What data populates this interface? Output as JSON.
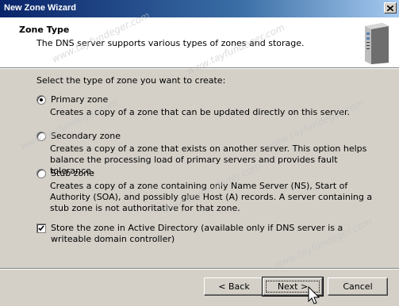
{
  "window": {
    "title": "New Zone Wizard",
    "close_glyph": "✕"
  },
  "header": {
    "title": "Zone Type",
    "subtitle": "The DNS server supports various types of zones and storage.",
    "icon": "server-icon"
  },
  "body": {
    "prompt": "Select the type of zone you want to create:",
    "options": [
      {
        "label": "Primary zone",
        "description": "Creates a copy of a zone that can be updated directly on this server.",
        "selected": true
      },
      {
        "label": "Secondary zone",
        "description": "Creates a copy of a zone that exists on another server. This option helps balance the processing load of primary servers and provides fault tolerance.",
        "selected": false
      },
      {
        "label": "Stub zone",
        "description": "Creates a copy of a zone containing only Name Server (NS), Start of Authority (SOA), and possibly glue Host (A) records. A server containing a stub zone is not authoritative for that zone.",
        "selected": false
      }
    ],
    "active_directory": {
      "label": "Store the zone in Active Directory (available only if DNS server is a writeable domain controller)",
      "checked": true
    }
  },
  "footer": {
    "back_label": "< Back",
    "next_label": "Next >",
    "cancel_label": "Cancel"
  },
  "watermark": "www.tayfundeger.com"
}
